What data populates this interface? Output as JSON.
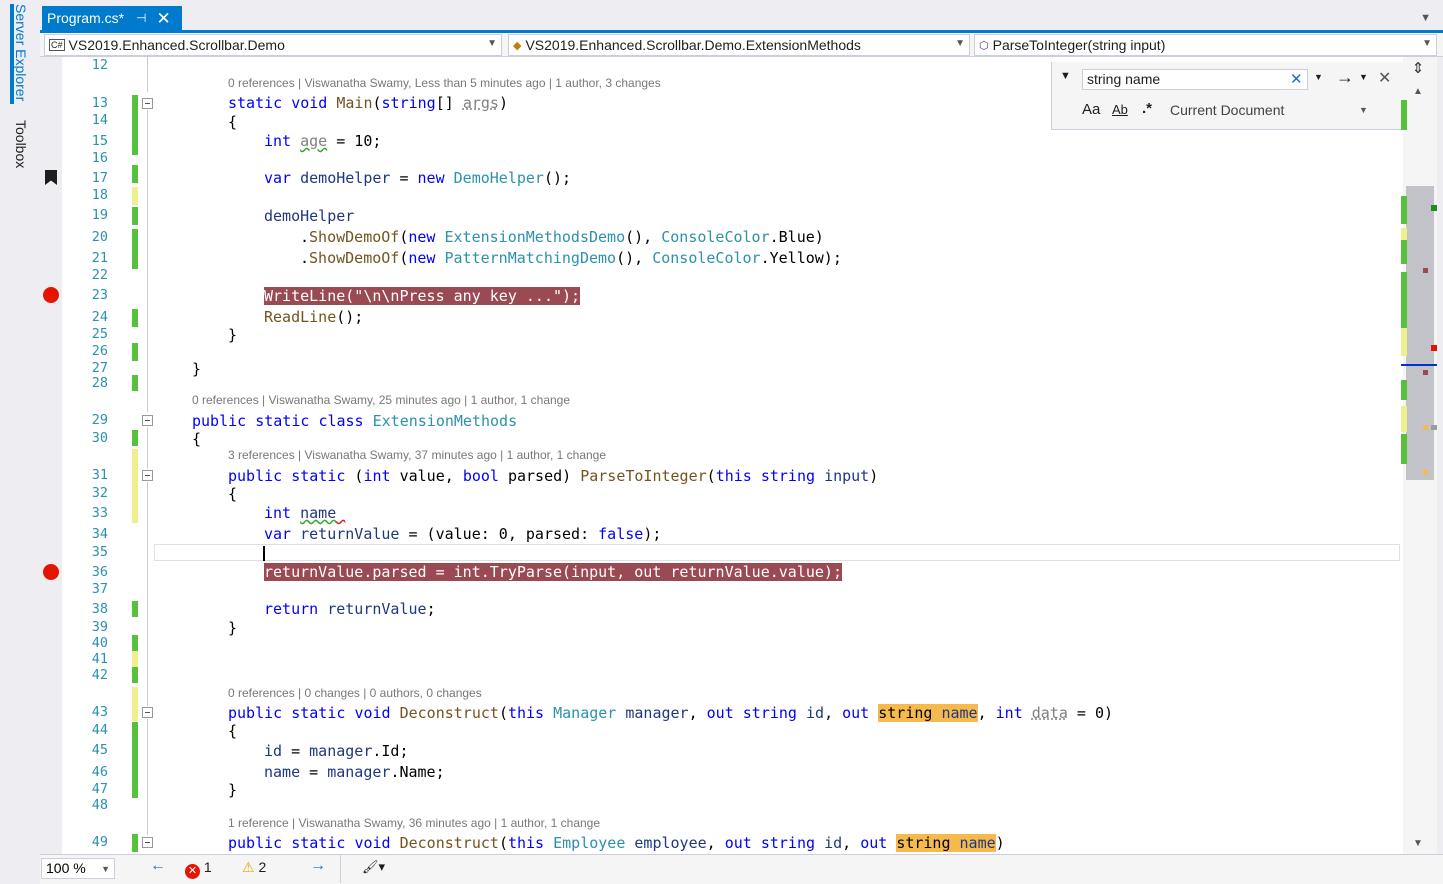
{
  "side_tabs": {
    "server_explorer": "Server Explorer",
    "toolbox": "Toolbox"
  },
  "tab": {
    "title": "Program.cs*",
    "pin": "⊣",
    "close": "✕"
  },
  "nav": {
    "project": "VS2019.Enhanced.Scrollbar.Demo",
    "type": "VS2019.Enhanced.Scrollbar.Demo.ExtensionMethods",
    "member": "ParseToInteger(string input)",
    "project_icon": "C#"
  },
  "find": {
    "query": "string name",
    "scope": "Current Document",
    "match_case": "Aa",
    "whole_word": "Ab",
    "regex": ".*"
  },
  "lenses": {
    "main": "0 references | Viswanatha Swamy, Less than 5 minutes ago | 1 author, 3 changes",
    "ext_class": "0 references | Viswanatha Swamy, 25 minutes ago | 1 author, 1 change",
    "parse": "3 references | Viswanatha Swamy, 37 minutes ago | 1 author, 1 change",
    "decon1": "0 references | 0 changes | 0 authors, 0 changes",
    "decon2": "1 reference | Viswanatha Swamy, 36 minutes ago | 1 author, 1 change"
  },
  "status": {
    "zoom": "100 %",
    "errors": "1",
    "warnings": "2"
  },
  "colors": {
    "accent": "#007acc",
    "breakpoint": "#e51400",
    "find_highlight": "#f6b94e",
    "keyword": "#0000ff",
    "type": "#2b91af"
  }
}
